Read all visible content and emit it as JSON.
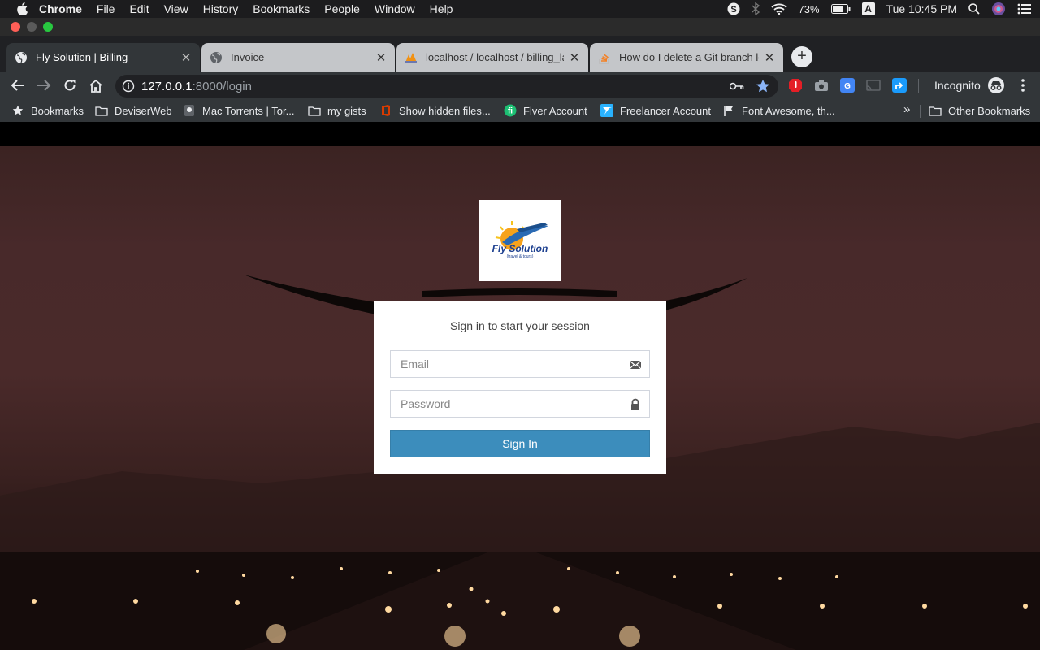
{
  "menubar": {
    "app_name": "Chrome",
    "items": [
      "File",
      "Edit",
      "View",
      "History",
      "Bookmarks",
      "People",
      "Window",
      "Help"
    ],
    "battery": "73%",
    "input_source": "A",
    "clock": "Tue 10:45 PM"
  },
  "tabs": [
    {
      "title": "Fly Solution | Billing",
      "favicon": "globe-icon",
      "active": true
    },
    {
      "title": "Invoice",
      "favicon": "globe-icon",
      "active": false
    },
    {
      "title": "localhost / localhost / billing_la",
      "favicon": "phpmyadmin-icon",
      "active": false
    },
    {
      "title": "How do I delete a Git branch lo",
      "favicon": "stackoverflow-icon",
      "active": false
    }
  ],
  "toolbar": {
    "url_host": "127.0.0.1",
    "url_rest": ":8000/login",
    "profile_label": "Incognito"
  },
  "bookmarks": {
    "items": [
      {
        "label": "Bookmarks",
        "icon": "star-icon"
      },
      {
        "label": "DeviserWeb",
        "icon": "folder-icon"
      },
      {
        "label": "Mac Torrents | Tor...",
        "icon": "site-icon"
      },
      {
        "label": "my gists",
        "icon": "folder-icon"
      },
      {
        "label": "Show hidden files...",
        "icon": "office-icon"
      },
      {
        "label": "Flver Account",
        "icon": "fiverr-icon"
      },
      {
        "label": "Freelancer Account",
        "icon": "freelancer-icon"
      },
      {
        "label": "Font Awesome, th...",
        "icon": "flag-icon"
      }
    ],
    "overflow": "»",
    "other": "Other Bookmarks"
  },
  "login": {
    "logo_text": "Fly Solution",
    "logo_subtext": "(travel & tours)",
    "message": "Sign in to start your session",
    "email_placeholder": "Email",
    "password_placeholder": "Password",
    "submit_label": "Sign In"
  },
  "colors": {
    "primary_button": "#3c8dbc",
    "active_tab": "#323639",
    "inactive_tab": "#c4c6c9"
  }
}
